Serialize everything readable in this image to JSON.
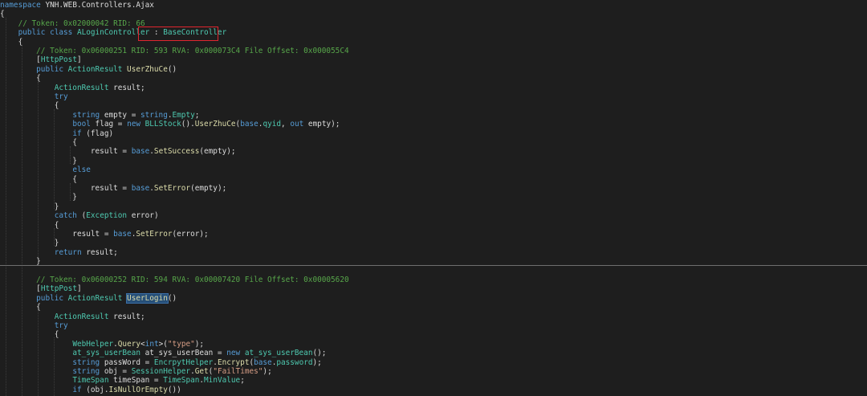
{
  "editor": {
    "lines": [
      [
        {
          "t": "namespace ",
          "c": "kw"
        },
        {
          "t": "YNH.WEB.Controllers.Ajax",
          "c": "pn"
        }
      ],
      [
        {
          "t": "{",
          "c": "pn"
        }
      ],
      [
        {
          "t": "    // Token: 0x02000042 RID: 66",
          "c": "cm"
        }
      ],
      [
        {
          "t": "    ",
          "c": "pn"
        },
        {
          "t": "public class ",
          "c": "kw"
        },
        {
          "t": "ALoginController",
          "c": "ty"
        },
        {
          "t": " : ",
          "c": "pn"
        },
        {
          "t": "BaseController",
          "c": "ty"
        }
      ],
      [
        {
          "t": "    {",
          "c": "pn"
        }
      ],
      [
        {
          "t": "        // Token: 0x06000251 RID: 593 RVA: 0x000073C4 File Offset: 0x000055C4",
          "c": "cm"
        }
      ],
      [
        {
          "t": "        [",
          "c": "pn"
        },
        {
          "t": "HttpPost",
          "c": "at"
        },
        {
          "t": "]",
          "c": "pn"
        }
      ],
      [
        {
          "t": "        ",
          "c": "pn"
        },
        {
          "t": "public ",
          "c": "kw"
        },
        {
          "t": "ActionResult ",
          "c": "ty"
        },
        {
          "t": "UserZhuCe",
          "c": "mt"
        },
        {
          "t": "()",
          "c": "pn"
        }
      ],
      [
        {
          "t": "        {",
          "c": "pn"
        }
      ],
      [
        {
          "t": "            ",
          "c": "pn"
        },
        {
          "t": "ActionResult ",
          "c": "ty"
        },
        {
          "t": "result;",
          "c": "pn"
        }
      ],
      [
        {
          "t": "            ",
          "c": "pn"
        },
        {
          "t": "try",
          "c": "kw"
        }
      ],
      [
        {
          "t": "            {",
          "c": "pn"
        }
      ],
      [
        {
          "t": "                ",
          "c": "pn"
        },
        {
          "t": "string ",
          "c": "kw"
        },
        {
          "t": "empty = ",
          "c": "pn"
        },
        {
          "t": "string",
          "c": "kw"
        },
        {
          "t": ".",
          "c": "pn"
        },
        {
          "t": "Empty",
          "c": "ty"
        },
        {
          "t": ";",
          "c": "pn"
        }
      ],
      [
        {
          "t": "                ",
          "c": "pn"
        },
        {
          "t": "bool ",
          "c": "kw"
        },
        {
          "t": "flag = ",
          "c": "pn"
        },
        {
          "t": "new ",
          "c": "kw"
        },
        {
          "t": "BLLStock",
          "c": "ty"
        },
        {
          "t": "().",
          "c": "pn"
        },
        {
          "t": "UserZhuCe",
          "c": "mt"
        },
        {
          "t": "(",
          "c": "pn"
        },
        {
          "t": "base",
          "c": "kw"
        },
        {
          "t": ".",
          "c": "pn"
        },
        {
          "t": "qyid",
          "c": "ty"
        },
        {
          "t": ", ",
          "c": "pn"
        },
        {
          "t": "out ",
          "c": "kw"
        },
        {
          "t": "empty);",
          "c": "pn"
        }
      ],
      [
        {
          "t": "                ",
          "c": "pn"
        },
        {
          "t": "if ",
          "c": "kw"
        },
        {
          "t": "(flag)",
          "c": "pn"
        }
      ],
      [
        {
          "t": "                {",
          "c": "pn"
        }
      ],
      [
        {
          "t": "                    result = ",
          "c": "pn"
        },
        {
          "t": "base",
          "c": "kw"
        },
        {
          "t": ".",
          "c": "pn"
        },
        {
          "t": "SetSuccess",
          "c": "mt"
        },
        {
          "t": "(empty);",
          "c": "pn"
        }
      ],
      [
        {
          "t": "                }",
          "c": "pn"
        }
      ],
      [
        {
          "t": "                ",
          "c": "pn"
        },
        {
          "t": "else",
          "c": "kw"
        }
      ],
      [
        {
          "t": "                {",
          "c": "pn"
        }
      ],
      [
        {
          "t": "                    result = ",
          "c": "pn"
        },
        {
          "t": "base",
          "c": "kw"
        },
        {
          "t": ".",
          "c": "pn"
        },
        {
          "t": "SetError",
          "c": "mt"
        },
        {
          "t": "(empty);",
          "c": "pn"
        }
      ],
      [
        {
          "t": "                }",
          "c": "pn"
        }
      ],
      [
        {
          "t": "            }",
          "c": "pn"
        }
      ],
      [
        {
          "t": "            ",
          "c": "pn"
        },
        {
          "t": "catch ",
          "c": "kw"
        },
        {
          "t": "(",
          "c": "pn"
        },
        {
          "t": "Exception ",
          "c": "ty"
        },
        {
          "t": "error)",
          "c": "pn"
        }
      ],
      [
        {
          "t": "            {",
          "c": "pn"
        }
      ],
      [
        {
          "t": "                result = ",
          "c": "pn"
        },
        {
          "t": "base",
          "c": "kw"
        },
        {
          "t": ".",
          "c": "pn"
        },
        {
          "t": "SetError",
          "c": "mt"
        },
        {
          "t": "(error);",
          "c": "pn"
        }
      ],
      [
        {
          "t": "            }",
          "c": "pn"
        }
      ],
      [
        {
          "t": "            ",
          "c": "pn"
        },
        {
          "t": "return ",
          "c": "kw"
        },
        {
          "t": "result;",
          "c": "pn"
        }
      ],
      [
        {
          "t": "        }",
          "c": "pn"
        }
      ],
      [],
      [
        {
          "t": "        // Token: 0x06000252 RID: 594 RVA: 0x00007420 File Offset: 0x00005620",
          "c": "cm"
        }
      ],
      [
        {
          "t": "        [",
          "c": "pn"
        },
        {
          "t": "HttpPost",
          "c": "at"
        },
        {
          "t": "]",
          "c": "pn"
        }
      ],
      [
        {
          "t": "        ",
          "c": "pn"
        },
        {
          "t": "public ",
          "c": "kw"
        },
        {
          "t": "ActionResult ",
          "c": "ty"
        },
        {
          "t": "UserLogin",
          "c": "mt",
          "hl": true
        },
        {
          "t": "()",
          "c": "pn"
        }
      ],
      [
        {
          "t": "        {",
          "c": "pn"
        }
      ],
      [
        {
          "t": "            ",
          "c": "pn"
        },
        {
          "t": "ActionResult ",
          "c": "ty"
        },
        {
          "t": "result;",
          "c": "pn"
        }
      ],
      [
        {
          "t": "            ",
          "c": "pn"
        },
        {
          "t": "try",
          "c": "kw"
        }
      ],
      [
        {
          "t": "            {",
          "c": "pn"
        }
      ],
      [
        {
          "t": "                ",
          "c": "pn"
        },
        {
          "t": "WebHelper",
          "c": "ty"
        },
        {
          "t": ".",
          "c": "pn"
        },
        {
          "t": "Query",
          "c": "mt"
        },
        {
          "t": "<",
          "c": "pn"
        },
        {
          "t": "int",
          "c": "kw"
        },
        {
          "t": ">(",
          "c": "pn"
        },
        {
          "t": "\"type\"",
          "c": "st"
        },
        {
          "t": ");",
          "c": "pn"
        }
      ],
      [
        {
          "t": "                ",
          "c": "pn"
        },
        {
          "t": "at_sys_userBean ",
          "c": "ty"
        },
        {
          "t": "at_sys_userBean = ",
          "c": "pn"
        },
        {
          "t": "new ",
          "c": "kw"
        },
        {
          "t": "at_sys_userBean",
          "c": "ty"
        },
        {
          "t": "();",
          "c": "pn"
        }
      ],
      [
        {
          "t": "                ",
          "c": "pn"
        },
        {
          "t": "string ",
          "c": "kw"
        },
        {
          "t": "passWord = ",
          "c": "pn"
        },
        {
          "t": "EncrpytHelper",
          "c": "ty"
        },
        {
          "t": ".",
          "c": "pn"
        },
        {
          "t": "Encrypt",
          "c": "mt"
        },
        {
          "t": "(",
          "c": "pn"
        },
        {
          "t": "base",
          "c": "kw"
        },
        {
          "t": ".",
          "c": "pn"
        },
        {
          "t": "password",
          "c": "ty"
        },
        {
          "t": ");",
          "c": "pn"
        }
      ],
      [
        {
          "t": "                ",
          "c": "pn"
        },
        {
          "t": "string ",
          "c": "kw"
        },
        {
          "t": "obj = ",
          "c": "pn"
        },
        {
          "t": "SessionHelper",
          "c": "ty"
        },
        {
          "t": ".",
          "c": "pn"
        },
        {
          "t": "Get",
          "c": "mt"
        },
        {
          "t": "(",
          "c": "pn"
        },
        {
          "t": "\"FailTimes\"",
          "c": "st"
        },
        {
          "t": ");",
          "c": "pn"
        }
      ],
      [
        {
          "t": "                ",
          "c": "pn"
        },
        {
          "t": "TimeSpan ",
          "c": "ty"
        },
        {
          "t": "timeSpan = ",
          "c": "pn"
        },
        {
          "t": "TimeSpan",
          "c": "ty"
        },
        {
          "t": ".",
          "c": "pn"
        },
        {
          "t": "MinValue",
          "c": "ty"
        },
        {
          "t": ";",
          "c": "pn"
        }
      ],
      [
        {
          "t": "                ",
          "c": "pn"
        },
        {
          "t": "if ",
          "c": "kw"
        },
        {
          "t": "(obj.",
          "c": "pn"
        },
        {
          "t": "IsNullOrEmpty",
          "c": "mt"
        },
        {
          "t": "())",
          "c": "pn"
        }
      ]
    ]
  }
}
